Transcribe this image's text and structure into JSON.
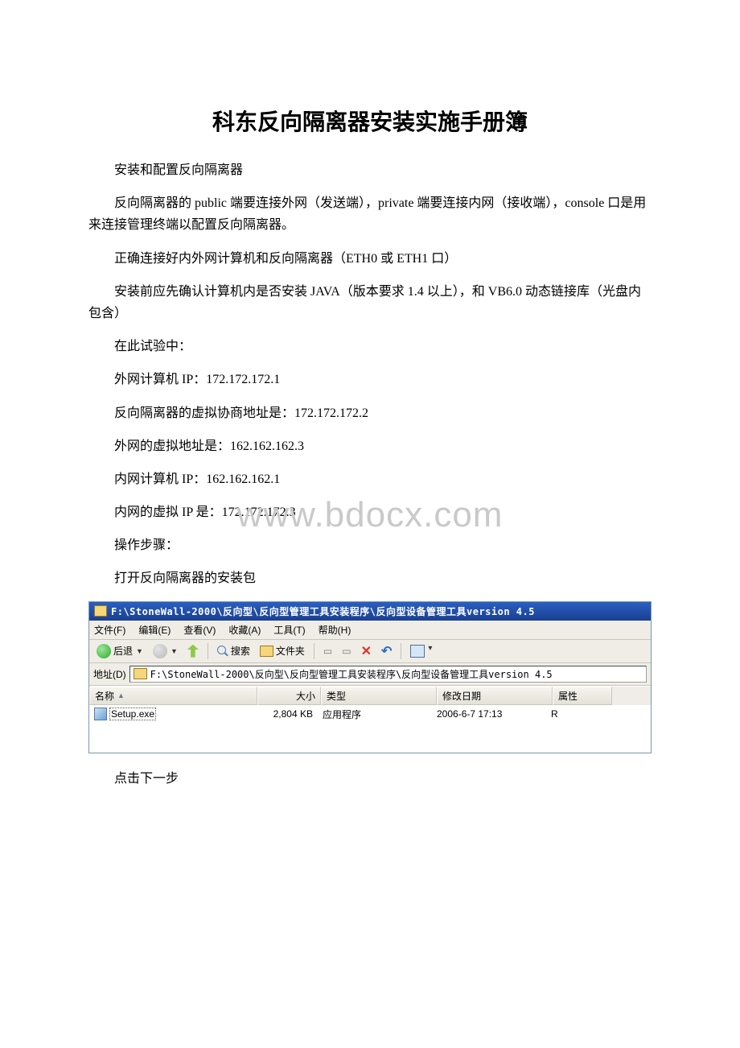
{
  "title": "科东反向隔离器安装实施手册簿",
  "paragraphs": {
    "p1": "安装和配置反向隔离器",
    "p2": "反向隔离器的 public 端要连接外网（发送端），private 端要连接内网（接收端），console 口是用来连接管理终端以配置反向隔离器。",
    "p3": "正确连接好内外网计算机和反向隔离器（ETH0 或 ETH1 口）",
    "p4": "安装前应先确认计算机内是否安装 JAVA（版本要求 1.4 以上），和 VB6.0 动态链接库（光盘内包含）",
    "p5": "在此试验中：",
    "p6": "外网计算机 IP：172.172.172.1",
    "p7": "反向隔离器的虚拟协商地址是：172.172.172.2",
    "p8": "外网的虚拟地址是：162.162.162.3",
    "p9": "内网计算机 IP：162.162.162.1",
    "p10": "内网的虚拟 IP 是：172.172.172.3",
    "p11": "操作步骤：",
    "p12": "打开反向隔离器的安装包",
    "p13": "点击下一步"
  },
  "watermark": "www.bdocx.com",
  "explorer": {
    "title_path": "F:\\StoneWall-2000\\反向型\\反向型管理工具安装程序\\反向型设备管理工具version 4.5",
    "menu": {
      "file": "文件(F)",
      "edit": "编辑(E)",
      "view": "查看(V)",
      "favorites": "收藏(A)",
      "tools": "工具(T)",
      "help": "帮助(H)"
    },
    "toolbar": {
      "back": "后退",
      "search": "搜索",
      "folders": "文件夹"
    },
    "address": {
      "label": "地址(D)",
      "value": "F:\\StoneWall-2000\\反向型\\反向型管理工具安装程序\\反向型设备管理工具version 4.5"
    },
    "columns": {
      "name": "名称",
      "size": "大小",
      "type": "类型",
      "date": "修改日期",
      "attr": "属性"
    },
    "file": {
      "name": "Setup.exe",
      "size": "2,804 KB",
      "type": "应用程序",
      "date": "2006-6-7 17:13",
      "attr": "R"
    }
  }
}
